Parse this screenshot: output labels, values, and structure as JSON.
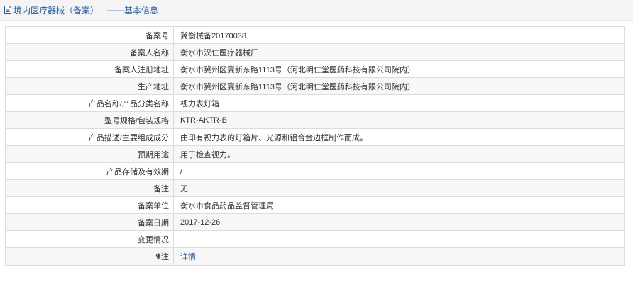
{
  "header": {
    "title": "境内医疗器械（备案）",
    "separator": "——",
    "subtitle": "基本信息",
    "icon": "document-icon"
  },
  "rows": [
    {
      "label": "备案号",
      "value": "冀衡械备20170038"
    },
    {
      "label": "备案人名称",
      "value": "衡水市汉仁医疗器械厂"
    },
    {
      "label": "备案人注册地址",
      "value": "衡水市冀州区冀新东路1113号（河北明仁堂医药科技有限公司院内）"
    },
    {
      "label": "生产地址",
      "value": "衡水市冀州区冀新东路1113号（河北明仁堂医药科技有限公司院内）"
    },
    {
      "label": "产品名称/产品分类名称",
      "value": "视力表灯箱"
    },
    {
      "label": "型号规格/包装规格",
      "value": "KTR-AKTR-B"
    },
    {
      "label": "产品描述/主要组成成分",
      "value": "由印有视力表的灯箱片、光源和铝合金边框制作而成。"
    },
    {
      "label": "预期用途",
      "value": "用于检查视力。"
    },
    {
      "label": "产品存储及有效期",
      "value": "/"
    },
    {
      "label": "备注",
      "value": "无"
    },
    {
      "label": "备案单位",
      "value": "衡水市食品药品监督管理局"
    },
    {
      "label": "备案日期",
      "value": "2017-12-26"
    },
    {
      "label": "变更情况",
      "value": ""
    }
  ],
  "note_row": {
    "label": "注",
    "icon": "lightbulb-icon",
    "link": "详情"
  },
  "colors": {
    "accent": "#2a5d9b",
    "border": "#dcdcdc",
    "row_alt": "#f7f7f7",
    "header_bg": "#f4f4f4"
  }
}
